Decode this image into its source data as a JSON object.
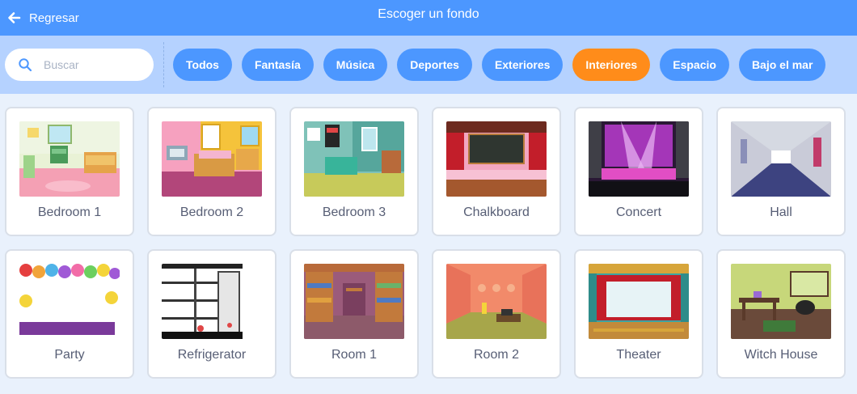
{
  "header": {
    "back_label": "Regresar",
    "title": "Escoger un fondo"
  },
  "search": {
    "placeholder": "Buscar"
  },
  "tags": [
    {
      "label": "Todos",
      "active": false
    },
    {
      "label": "Fantasía",
      "active": false
    },
    {
      "label": "Música",
      "active": false
    },
    {
      "label": "Deportes",
      "active": false
    },
    {
      "label": "Exteriores",
      "active": false
    },
    {
      "label": "Interiores",
      "active": true
    },
    {
      "label": "Espacio",
      "active": false
    },
    {
      "label": "Bajo el mar",
      "active": false
    }
  ],
  "backdrops": [
    {
      "name": "Bedroom 1"
    },
    {
      "name": "Bedroom 2"
    },
    {
      "name": "Bedroom 3"
    },
    {
      "name": "Chalkboard"
    },
    {
      "name": "Concert"
    },
    {
      "name": "Hall"
    },
    {
      "name": "Party"
    },
    {
      "name": "Refrigerator"
    },
    {
      "name": "Room 1"
    },
    {
      "name": "Room 2"
    },
    {
      "name": "Theater"
    },
    {
      "name": "Witch House"
    }
  ],
  "colors": {
    "header": "#4c97ff",
    "filter_bar": "#b5d2ff",
    "tag": "#4c97ff",
    "tag_active": "#ff8c1a",
    "page": "#e9f1fc"
  }
}
